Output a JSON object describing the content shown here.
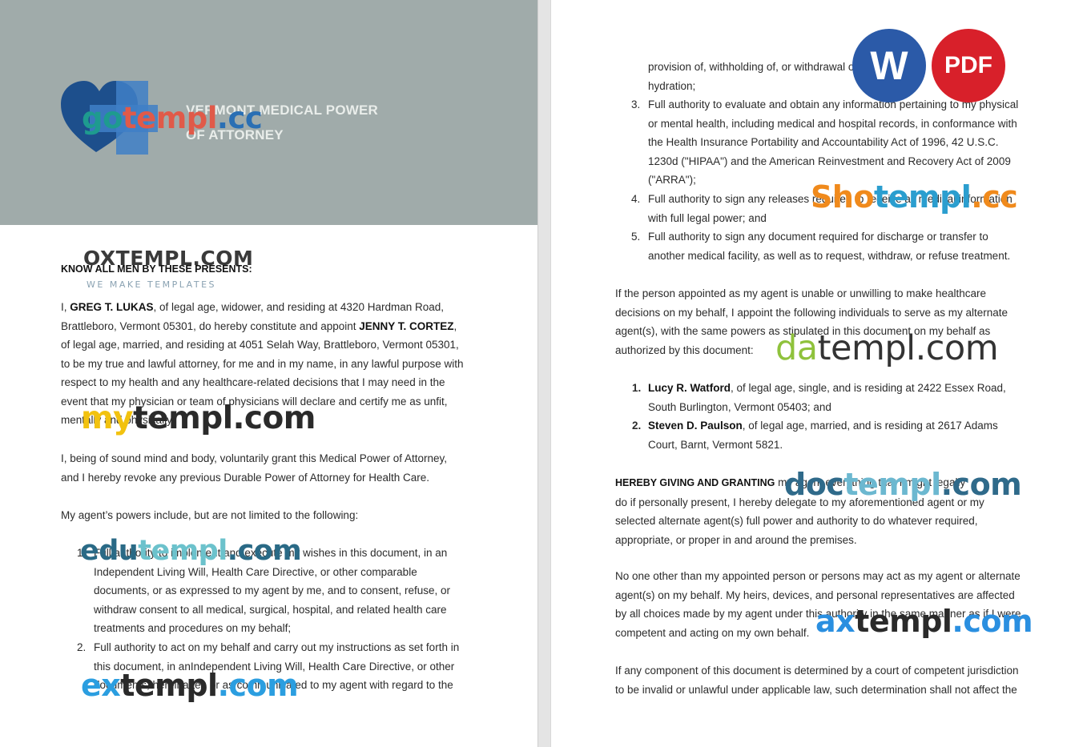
{
  "document": {
    "title_line1": "VERMONT MEDICAL POWER",
    "title_line2": "OF ATTORNEY"
  },
  "left_page": {
    "heading": "KNOW ALL MEN BY THESE PRESENTS:",
    "intro": {
      "l1_a": "I, ",
      "l1_name": "GREG T. LUKAS",
      "l1_b": ", of legal age, widower, and residing at 4320 Hardman Road,",
      "l2_a": "Brattleboro, Vermont 05301, do hereby constitute and appoint ",
      "l2_name": "JENNY T. CORTEZ",
      "l2_b": ",",
      "l3": "of legal age, married, and residing at 4051 Selah Way, Brattleboro, Vermont 05301,",
      "l4": "to be my true and lawful attorney, for me and in my name, in any lawful purpose with",
      "l5": "respect to my health and any healthcare-related decisions that I may need in the",
      "l6": "event that my physician or team of physicians will declare and certify me as unfit,",
      "l7": "mentally and physically."
    },
    "grant": {
      "l1": "I, being of sound mind and body, voluntarily grant this Medical Power of Attorney,",
      "l2": "and I hereby revoke any previous Durable Power of Attorney for Health Care."
    },
    "powers_intro": "My agent’s powers include, but are not limited to the following:",
    "item1": {
      "num": "1.",
      "l1": "Full authority to implement and execute my wishes in this document, in an",
      "l2": "Independent Living Will, Health Care Directive, or other comparable",
      "l3": "documents, or as expressed to my agent by me, and to consent, refuse, or",
      "l4": "withdraw consent to all medical, surgical, hospital, and related health care",
      "l5": "treatments and procedures on my behalf;"
    },
    "item2": {
      "num": "2.",
      "l1": "Full authority to act on my behalf and carry out my instructions as set forth in",
      "l2": "this document, in anIndependent Living Will, Health Care Directive, or other",
      "l3": "documents, hereinafter, or as communicated to my agent with regard to the"
    }
  },
  "right_page": {
    "item2_cont": {
      "l1": "provision of, withholding of, or withdrawal of nutrition and",
      "l2": "hydration;"
    },
    "item3": {
      "num": "3.",
      "l1": "Full authority to evaluate and obtain any information pertaining to my physical",
      "l2": "or mental health, including medical and hospital records, in conformance with",
      "l3": "the Health Insurance Portability and Accountability Act of 1996, 42 U.S.C.",
      "l4": "1230d (\"HIPAA\") and the American Reinvestment and Recovery Act of 2009",
      "l5": "(\"ARRA\");"
    },
    "item4": {
      "num": "4.",
      "l1": "Full authority to sign any releases required to receive all medical information",
      "l2": "with full legal power; and"
    },
    "item5": {
      "num": "5.",
      "l1": "Full authority to sign any document required for discharge or transfer to",
      "l2": "another medical facility, as well as to request, withdraw, or refuse treatment."
    },
    "alternate": {
      "l1": "If the person appointed as my agent is unable or unwilling to make healthcare",
      "l2": "decisions on my behalf, I appoint the following individuals to serve as my alternate",
      "l3": "agent(s), with the same powers as stipulated in this document on my behalf as",
      "l4": "authorized by this document:"
    },
    "alt1": {
      "num": "1.",
      "name": "Lucy R. Watford",
      "l1_rest": ", of legal age, single, and is residing at 2422 Essex Road,",
      "l2": "South Burlington, Vermont 05403; and"
    },
    "alt2": {
      "num": "2.",
      "name": "Steven D. Paulson",
      "l1_rest": ", of legal age, married, and is residing at 2617 Adams",
      "l2": "Court, Barnt, Vermont 5821."
    },
    "granting": {
      "bold": "HEREBY GIVING AND GRANTING",
      "l1_rest": " my agent everything that I might legally",
      "l2": "do if personally present, I hereby delegate to my aforementioned agent or my",
      "l3": "selected alternate agent(s) full power and authority to do whatever required,",
      "l4": "appropriate, or proper in and around the premises."
    },
    "no_other": {
      "l1": "No one other than my appointed person or persons may act as my agent or alternate",
      "l2": "agent(s) on my behalf. My heirs, devices, and personal representatives are affected",
      "l3": "by all choices made by my agent under this authority in the same manner as if I were",
      "l4": "competent and acting on my own behalf."
    },
    "severability": {
      "l1": "If any component of this document is determined by a court of competent jurisdiction",
      "l2": "to be invalid or unlawful under applicable law, such determination shall not affect the"
    }
  },
  "watermarks": {
    "gotempl_a": "go",
    "gotempl_b": "templ",
    "gotempl_c": ".cc",
    "oxtempl": "OXTEMPL.COM",
    "oxtempl_tag": "WE MAKE TEMPLATES",
    "mytempl_a": "my",
    "mytempl_b": "templ.com",
    "edutempl_a": "edu",
    "edutempl_b": "templ",
    "edutempl_c": ".com",
    "extempl_a": "ex",
    "extempl_b": "templ",
    "extempl_c": ".com",
    "shotempl_a": "Sho",
    "shotempl_b": "templ",
    "shotempl_c": ".cc",
    "datempl_a": "da",
    "datempl_b": "templ.com",
    "doctempl_a": "doc",
    "doctempl_b": "templ",
    "doctempl_c": ".com",
    "axtempl_a": "ax",
    "axtempl_b": "templ",
    "axtempl_c": ".com"
  },
  "badges": {
    "word": "W",
    "pdf": "PDF"
  },
  "colors": {
    "header_band": "#a0abaa",
    "word_badge": "#2b5aa8",
    "pdf_badge": "#d8202a"
  }
}
